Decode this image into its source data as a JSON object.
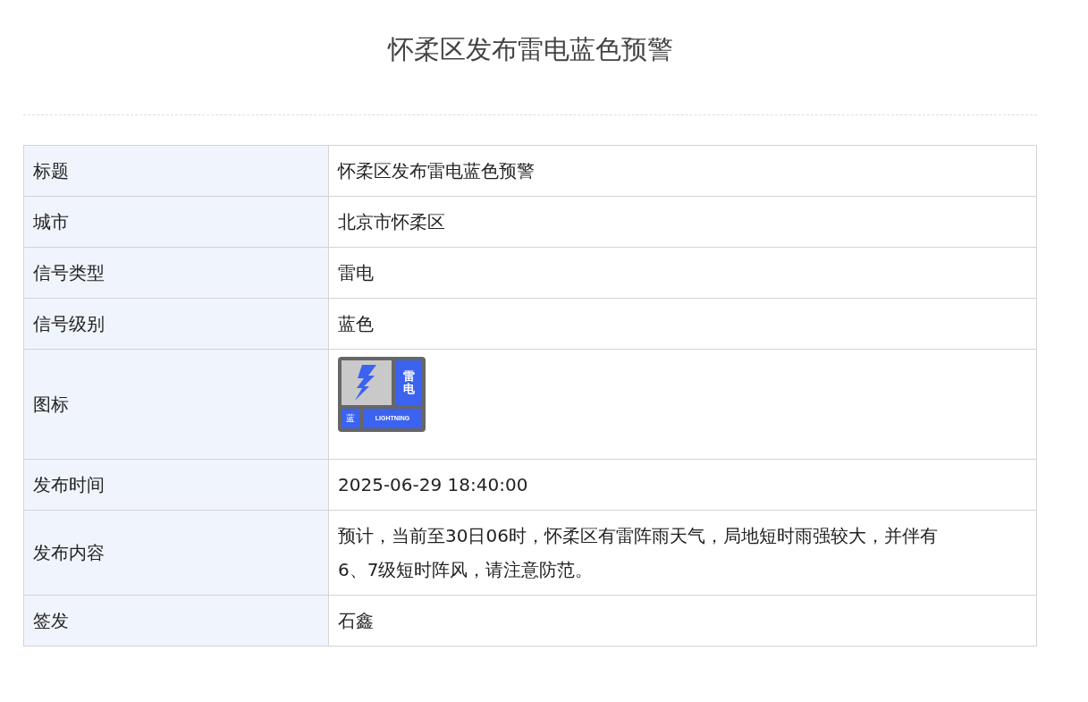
{
  "title": "怀柔区发布雷电蓝色预警",
  "rows": [
    {
      "kind": "text",
      "label": "标题",
      "value": "怀柔区发布雷电蓝色预警"
    },
    {
      "kind": "text",
      "label": "城市",
      "value": "北京市怀柔区"
    },
    {
      "kind": "text",
      "label": "信号类型",
      "value": "雷电"
    },
    {
      "kind": "text",
      "label": "信号级别",
      "value": "蓝色"
    },
    {
      "kind": "icon",
      "label": "图标",
      "icon": {
        "type_text": "雷电",
        "level_text": "蓝",
        "english": "LIGHTNING"
      }
    },
    {
      "kind": "text",
      "label": "发布时间",
      "value": "2025-06-29 18:40:00"
    },
    {
      "kind": "text",
      "label": "发布内容",
      "value": "预计，当前至30日06时，怀柔区有雷阵雨天气，局地短时雨强较大，并伴有6、7级短时阵风，请注意防范。"
    },
    {
      "kind": "text",
      "label": "签发",
      "value": "石鑫"
    }
  ]
}
